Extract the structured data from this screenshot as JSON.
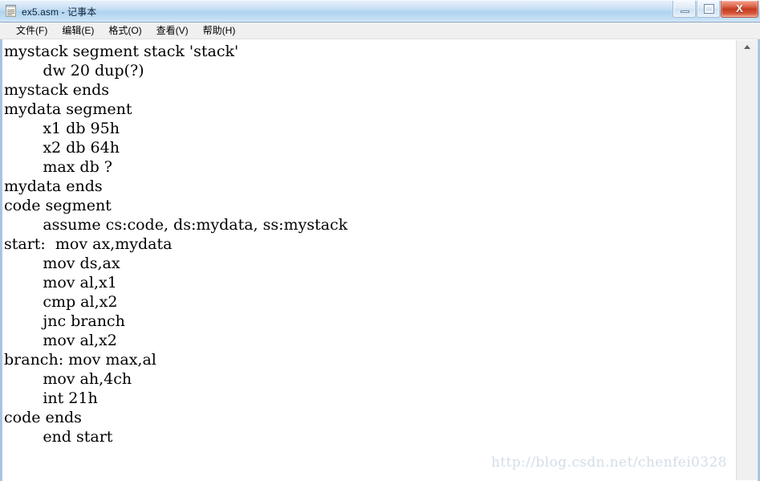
{
  "window": {
    "title": "ex5.asm - 记事本",
    "icon": "notepad-document-icon"
  },
  "window_controls": {
    "minimize_label": "",
    "restore_label": "",
    "close_label": "X",
    "minimize_icon": "minimize-icon",
    "restore_icon": "restore-icon",
    "close_icon": "close-icon"
  },
  "menu": {
    "items": [
      {
        "label": "文件(F)"
      },
      {
        "label": "编辑(E)"
      },
      {
        "label": "格式(O)"
      },
      {
        "label": "查看(V)"
      },
      {
        "label": "帮助(H)"
      }
    ]
  },
  "editor": {
    "content": "mystack segment stack 'stack'\n        dw 20 dup(?)\nmystack ends\nmydata segment\n        x1 db 95h\n        x2 db 64h\n        max db ?\nmydata ends\ncode segment\n        assume cs:code, ds:mydata, ss:mystack\nstart:  mov ax,mydata\n        mov ds,ax\n        mov al,x1\n        cmp al,x2\n        jnc branch\n        mov al,x2\nbranch: mov max,al\n        mov ah,4ch\n        int 21h\ncode ends\n        end start",
    "lines": [
      "mystack segment stack 'stack'",
      "        dw 20 dup(?)",
      "mystack ends",
      "mydata segment",
      "        x1 db 95h",
      "        x2 db 64h",
      "        max db ?",
      "mydata ends",
      "code segment",
      "        assume cs:code, ds:mydata, ss:mystack",
      "start:  mov ax,mydata",
      "        mov ds,ax",
      "        mov al,x1",
      "        cmp al,x2",
      "        jnc branch",
      "        mov al,x2",
      "branch: mov max,al",
      "        mov ah,4ch",
      "        int 21h",
      "code ends",
      "        end start"
    ]
  },
  "scrollbar": {
    "up_arrow_icon": "arrow-up-icon",
    "orientation": "vertical"
  },
  "watermark": {
    "text": "http://blog.csdn.net/chenfei0328"
  },
  "colors": {
    "titlebar_accent": "#aed2ef",
    "close_button": "#c43c20",
    "menu_background": "#f0f0f0",
    "text": "#000000",
    "watermark": "#d3dde8"
  }
}
